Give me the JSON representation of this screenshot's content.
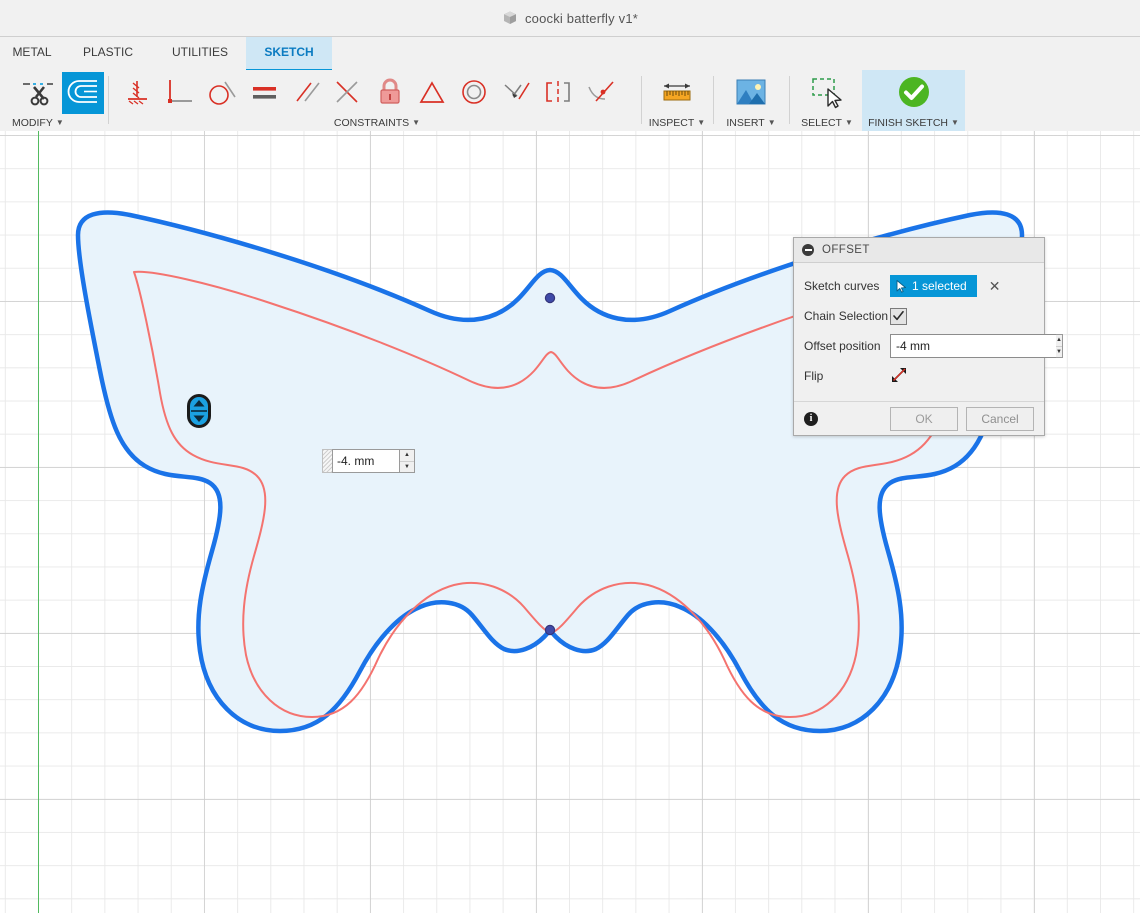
{
  "titlebar": {
    "document_name": "coocki batterfly v1*",
    "doc_icon": "cube-icon"
  },
  "tabs": [
    {
      "label": "METAL",
      "active": false
    },
    {
      "label": "PLASTIC",
      "active": false
    },
    {
      "label": "UTILITIES",
      "active": false
    },
    {
      "label": "SKETCH",
      "active": true
    }
  ],
  "ribbon": {
    "panels": [
      {
        "caption": "MODIFY",
        "has_caret": true,
        "tools": [
          {
            "name": "trim-tool",
            "tooltip": "Trim"
          },
          {
            "name": "offset-tool",
            "tooltip": "Offset",
            "selected": true
          }
        ]
      },
      {
        "caption": "CONSTRAINTS",
        "has_caret": true,
        "tools": [
          {
            "name": "horizontal-vertical-constraint",
            "tooltip": "Horizontal/Vertical"
          },
          {
            "name": "perpendicular-constraint",
            "tooltip": "Perpendicular"
          },
          {
            "name": "tangent-constraint",
            "tooltip": "Tangent"
          },
          {
            "name": "equal-constraint",
            "tooltip": "Equal"
          },
          {
            "name": "parallel-constraint",
            "tooltip": "Parallel"
          },
          {
            "name": "collinear-constraint",
            "tooltip": "Collinear"
          },
          {
            "name": "fix-unfix-constraint",
            "tooltip": "Fix/UnFix"
          },
          {
            "name": "midpoint-constraint",
            "tooltip": "Midpoint"
          },
          {
            "name": "concentric-constraint",
            "tooltip": "Concentric"
          },
          {
            "name": "coincident-constraint",
            "tooltip": "Coincident"
          },
          {
            "name": "symmetry-constraint",
            "tooltip": "Symmetry"
          },
          {
            "name": "curvature-constraint",
            "tooltip": "Curvature"
          }
        ]
      },
      {
        "caption": "INSPECT",
        "has_caret": true,
        "tools": [
          {
            "name": "measure-tool",
            "tooltip": "Measure"
          }
        ]
      },
      {
        "caption": "INSERT",
        "has_caret": true,
        "tools": [
          {
            "name": "insert-image-tool",
            "tooltip": "Insert Image"
          }
        ]
      },
      {
        "caption": "SELECT",
        "has_caret": true,
        "tools": [
          {
            "name": "select-tool",
            "tooltip": "Select"
          }
        ]
      },
      {
        "caption": "FINISH SKETCH",
        "has_caret": true,
        "highlighted": true,
        "tools": [
          {
            "name": "finish-sketch-tool",
            "tooltip": "Finish Sketch"
          }
        ]
      }
    ]
  },
  "canvas": {
    "grid_visible": true,
    "vertical_axis_color": "#3bb54a",
    "profile_fill_color": "#e8f3fb",
    "selected_curve_color": "#1a73e8",
    "offset_preview_color": "#f4736f",
    "manipulator": {
      "name": "offset-drag-handle",
      "color": "#1ba1e2"
    },
    "inline_value": {
      "value": "-4. mm",
      "name": "offset-distance-input"
    }
  },
  "dialog": {
    "title": "OFFSET",
    "collapse_icon": "collapse-icon",
    "fields": {
      "sketch_curves_label": "Sketch curves",
      "sketch_curves_value": "1 selected",
      "sketch_curves_clear": "✕",
      "chain_selection_label": "Chain Selection",
      "chain_selection_checked": true,
      "offset_position_label": "Offset position",
      "offset_position_value": "-4 mm",
      "flip_label": "Flip",
      "flip_icon": "flip-icon"
    },
    "footer": {
      "info_icon": "info-icon",
      "ok_label": "OK",
      "cancel_label": "Cancel"
    }
  }
}
